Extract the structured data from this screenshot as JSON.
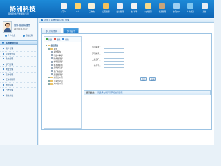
{
  "brand": {
    "title": "扬洲科技",
    "subtitle": "网络软件开发服务专家"
  },
  "nav": [
    {
      "label": "门户",
      "color": "#f2f2f2",
      "icon": "home-icon"
    },
    {
      "label": "个人",
      "color": "#ffd36b",
      "icon": "user-icon"
    },
    {
      "label": "工作台",
      "color": "#f7f0d8",
      "icon": "desk-icon"
    },
    {
      "label": "日程管理",
      "color": "#f4c15a",
      "icon": "calendar-icon"
    },
    {
      "label": "知识管理",
      "color": "#e8eef6",
      "icon": "book-icon"
    },
    {
      "label": "电子邮件",
      "color": "#f2f2f2",
      "icon": "mail-icon"
    },
    {
      "label": "公文管理",
      "color": "#f7d98a",
      "icon": "folder-icon"
    },
    {
      "label": "档案管理",
      "color": "#c8a47a",
      "icon": "archive-icon"
    },
    {
      "label": "协同办公",
      "color": "#9fd0f2",
      "icon": "team-icon"
    },
    {
      "label": "人力资源",
      "color": "#7ec6f0",
      "icon": "people-icon"
    },
    {
      "label": "系统",
      "color": "#e9eef3",
      "icon": "tools-icon"
    }
  ],
  "user": {
    "welcome": "您好:超级管理员",
    "date": "2013年11月13日",
    "links": [
      "个人信息",
      "修改密码"
    ]
  },
  "menu": {
    "header": "系统管理菜单",
    "items": [
      "用户管理",
      "权限组管理",
      "角色管理",
      "部门管理",
      "岗位管理",
      "菜单管理",
      "工作流管理",
      "数据字典",
      "日志管理",
      "系统参数"
    ]
  },
  "breadcrumb": "首页 > 系统管理 > 部门管理",
  "tabs": {
    "list": "部门列表维护",
    "add": "部门设计"
  },
  "tree": {
    "tools": [
      {
        "label": "新建",
        "color": "#3aa53a"
      },
      {
        "label": "删除",
        "color": "#d94a3a"
      },
      {
        "label": "刷新",
        "color": "#3a86d9"
      }
    ],
    "nodes": [
      {
        "label": "组织机构",
        "level": 0,
        "type": "folder"
      },
      {
        "label": "总部",
        "level": 1,
        "type": "folder"
      },
      {
        "label": "总经理办",
        "level": 2,
        "type": "file"
      },
      {
        "label": "行政人事部",
        "level": 2,
        "type": "file"
      },
      {
        "label": "财务管理部",
        "level": 2,
        "type": "file"
      },
      {
        "label": "市场营销部",
        "level": 2,
        "type": "file"
      },
      {
        "label": "技术研发部",
        "level": 2,
        "type": "file"
      },
      {
        "label": "采购供应部",
        "level": 2,
        "type": "file"
      },
      {
        "label": "生产制造部",
        "level": 2,
        "type": "file"
      },
      {
        "label": "质量管理部",
        "level": 2,
        "type": "file"
      },
      {
        "label": "北京分公司",
        "level": 1,
        "type": "folder"
      },
      {
        "label": "上海分公司",
        "level": 1,
        "type": "folder"
      },
      {
        "label": "广州分公司",
        "level": 1,
        "type": "folder"
      }
    ]
  },
  "form": {
    "fields": [
      {
        "label": "部门名称：",
        "value": ""
      },
      {
        "label": "部门编号：",
        "value": ""
      },
      {
        "label": "上级部门：",
        "value": ""
      },
      {
        "label": "排序号：",
        "value": ""
      }
    ],
    "save_label": "保存",
    "cancel_label": "取消"
  },
  "tip": {
    "label": "提示信息：",
    "text": "请选择左侧部门节点进行编辑"
  }
}
